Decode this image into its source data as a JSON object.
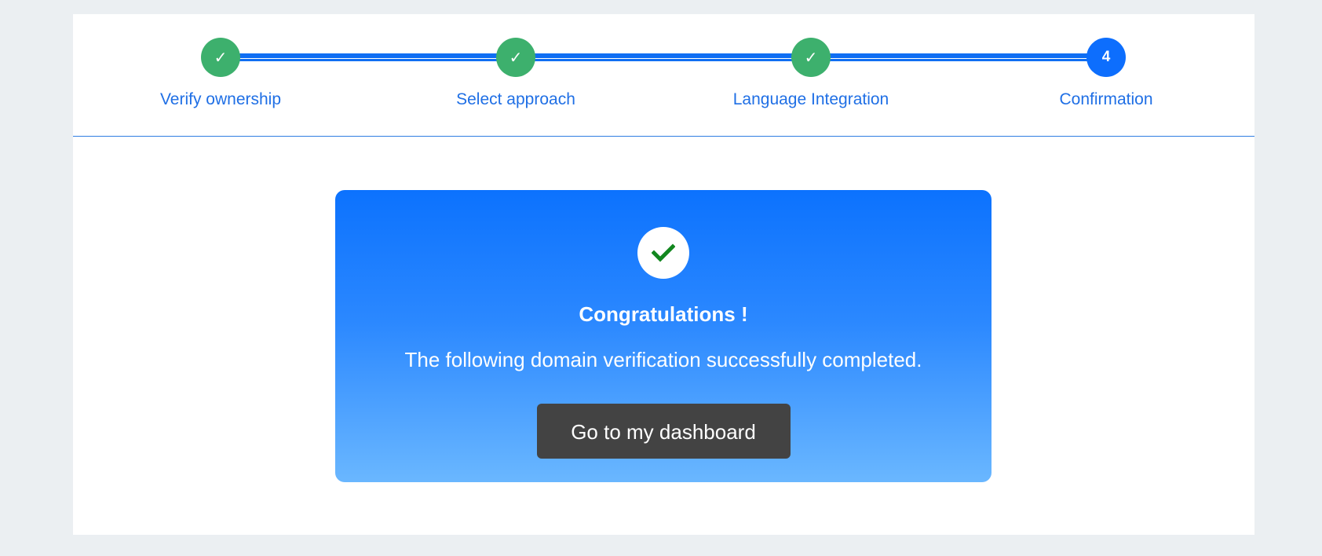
{
  "wizard": {
    "steps": [
      {
        "indicator": "✓",
        "label": "Verify ownership",
        "status": "done"
      },
      {
        "indicator": "✓",
        "label": "Select approach",
        "status": "done"
      },
      {
        "indicator": "✓",
        "label": "Language Integration",
        "status": "done"
      },
      {
        "indicator": "4",
        "label": "Confirmation",
        "status": "active"
      }
    ]
  },
  "confirmation": {
    "icon": "check-icon",
    "title": "Congratulations !",
    "message": "The following domain verification successfully completed.",
    "button_label": "Go to my dashboard"
  },
  "colors": {
    "done": "#3db06d",
    "active": "#0d6efd",
    "link_text": "#1f6fe5",
    "button": "#434343"
  }
}
